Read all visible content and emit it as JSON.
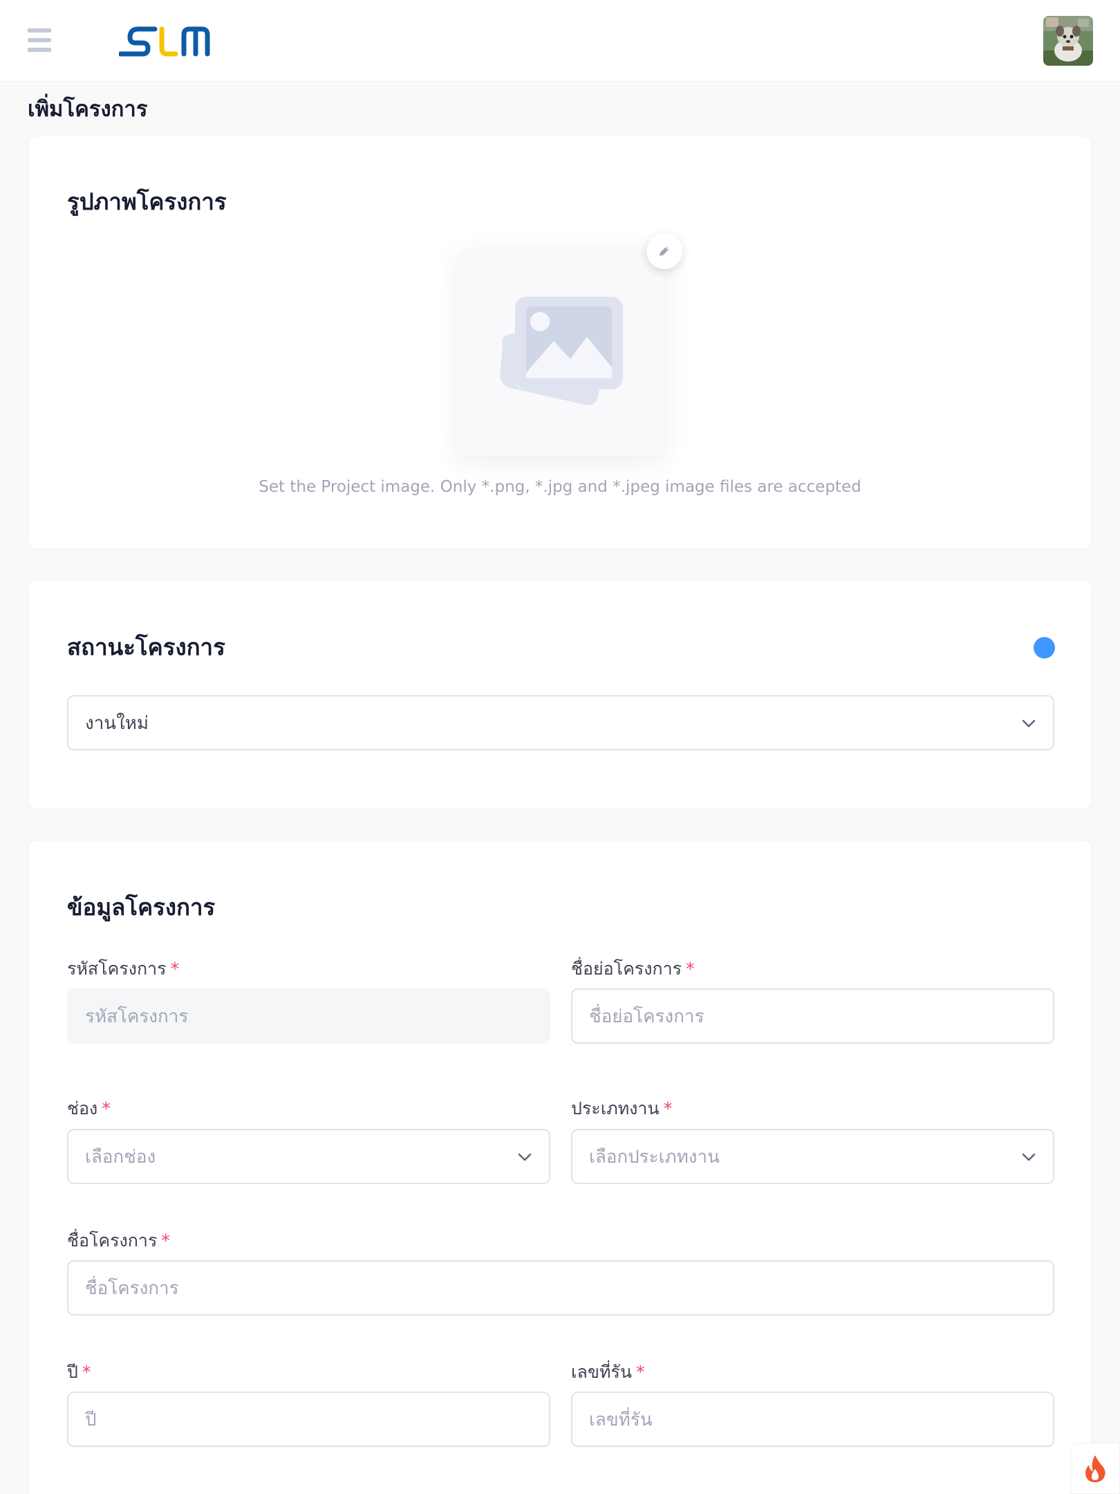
{
  "header": {
    "logo_text": "SLM",
    "menu_icon": "hamburger-menu-icon",
    "avatar_icon": "user-avatar"
  },
  "page": {
    "title": "เพิ่มโครงการ"
  },
  "image_section": {
    "title": "รูปภาพโครงการ",
    "hint": "Set the Project image. Only *.png, *.jpg and *.jpeg image files are accepted",
    "placeholder_icon": "image-placeholder-icon",
    "edit_icon": "pencil-icon"
  },
  "status_section": {
    "title": "สถานะโครงการ",
    "selected": "งานใหม่",
    "status_color": "#3e97ff"
  },
  "info_section": {
    "title": "ข้อมูลโครงการ",
    "required_mark": "*",
    "fields": {
      "project_code": {
        "label": "รหัสโครงการ",
        "placeholder": "รหัสโครงการ"
      },
      "project_short_name": {
        "label": "ชื่อย่อโครงการ",
        "placeholder": "ชื่อย่อโครงการ"
      },
      "channel": {
        "label": "ช่อง",
        "placeholder": "เลือกช่อง"
      },
      "work_type": {
        "label": "ประเภทงาน",
        "placeholder": "เลือกประเภทงาน"
      },
      "project_name": {
        "label": "ชื่อโครงการ",
        "placeholder": "ชื่อโครงการ"
      },
      "year": {
        "label": "ปี",
        "placeholder": "ปี"
      },
      "run_number": {
        "label": "เลขที่รัน",
        "placeholder": "เลขที่รัน"
      }
    }
  },
  "colors": {
    "accent": "#3e97ff",
    "required": "#f1416c",
    "logo_blue": "#0d5ba8",
    "logo_yellow": "#f5c400"
  }
}
